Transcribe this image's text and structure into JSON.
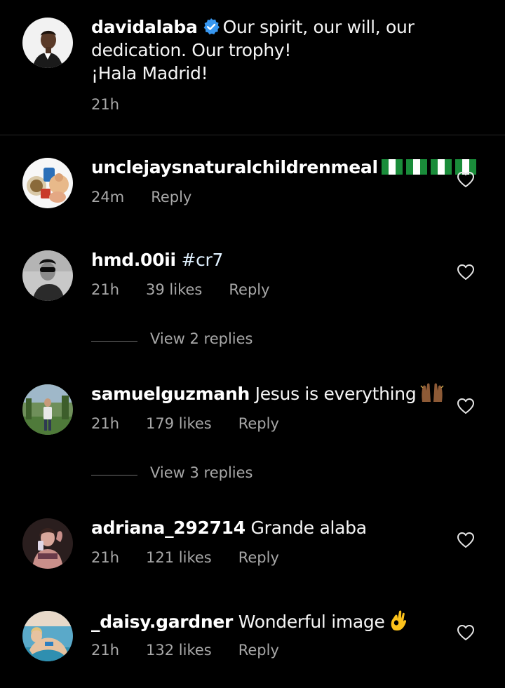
{
  "caption": {
    "username": "davidalaba",
    "text_lines": [
      "Our spirit, our will, our",
      "dedication. Our trophy!",
      "¡Hala Madrid!"
    ],
    "time": "21h",
    "verified_icon": "verified-badge-icon",
    "avatar_icon": "avatar-icon"
  },
  "comments": [
    {
      "username": "unclejaysnaturalchildrenmeal",
      "text": "",
      "flags": [
        "nigeria-flag",
        "nigeria-flag",
        "nigeria-flag",
        "nigeria-flag"
      ],
      "time": "24m",
      "likes": "",
      "reply_label": "Reply",
      "like_icon": "heart-icon"
    },
    {
      "username": "hmd.00ii",
      "text": "#cr7",
      "time": "21h",
      "likes": "39 likes",
      "reply_label": "Reply",
      "view_replies": "View 2 replies",
      "like_icon": "heart-icon"
    },
    {
      "username": "samuelguzmanh",
      "text": "Jesus is everything",
      "emoji": "raising-hands-emoji",
      "time": "21h",
      "likes": "179 likes",
      "reply_label": "Reply",
      "view_replies": "View 3 replies",
      "like_icon": "heart-icon"
    },
    {
      "username": "adriana_292714",
      "text": "Grande alaba",
      "time": "21h",
      "likes": "121 likes",
      "reply_label": "Reply",
      "like_icon": "heart-icon"
    },
    {
      "username": "_daisy.gardner",
      "text": "Wonderful image",
      "emoji": "ok-hand-emoji",
      "time": "21h",
      "likes": "132 likes",
      "reply_label": "Reply",
      "like_icon": "heart-icon"
    }
  ],
  "colors": {
    "background": "#000000",
    "text": "#f5f5f5",
    "secondary_text": "#a8a8a8",
    "divider": "#262626",
    "verified_blue": "#3897f0",
    "nigeria_green": "#1a8c3a"
  }
}
